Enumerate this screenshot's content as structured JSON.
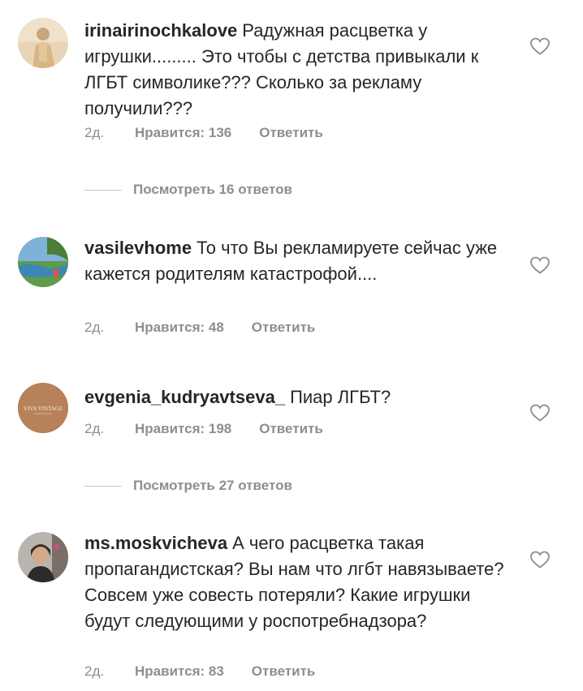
{
  "comments": [
    {
      "username": "irinairinochkalove",
      "text": "Радужная расцветка у игрушки......... Это чтобы с детства привыкали к ЛГБТ символике??? Сколько за рекламу получили???",
      "time": "2д.",
      "likes": "Нравится: 136",
      "reply": "Ответить",
      "view_replies": "Посмотреть 16 ответов"
    },
    {
      "username": "vasilevhome",
      "text": "То что Вы рекламируете сейчас уже кажется родителям катастрофой....",
      "time": "2д.",
      "likes": "Нравится: 48",
      "reply": "Ответить"
    },
    {
      "username": "evgenia_kudryavtseva_",
      "text": "Пиар ЛГБТ?",
      "time": "2д.",
      "likes": "Нравится: 198",
      "reply": "Ответить",
      "view_replies": "Посмотреть 27 ответов",
      "avatar_text": "VIVA VINTAGE"
    },
    {
      "username": "ms.moskvicheva",
      "text": "А чего расцветка такая пропагандистская? Вы нам что лгбт навязываете? Совсем уже совесть потеряли? Какие игрушки будут следующими у роспотребнадзора?",
      "time": "2д.",
      "likes": "Нравится: 83",
      "reply": "Ответить"
    }
  ],
  "colors": {
    "text": "#262626",
    "secondary": "#8e8e8e",
    "heart": "#8e8e8e"
  }
}
